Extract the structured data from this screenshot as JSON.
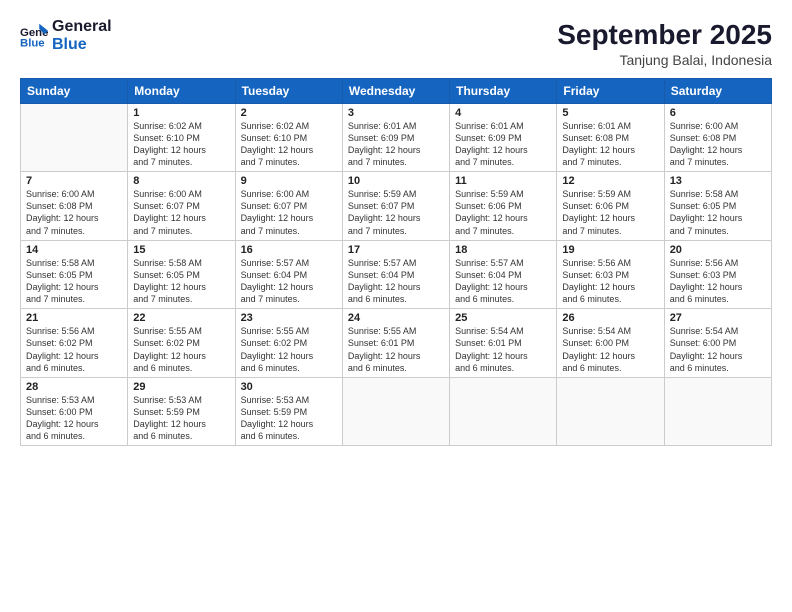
{
  "logo": {
    "line1": "General",
    "line2": "Blue"
  },
  "header": {
    "title": "September 2025",
    "subtitle": "Tanjung Balai, Indonesia"
  },
  "weekdays": [
    "Sunday",
    "Monday",
    "Tuesday",
    "Wednesday",
    "Thursday",
    "Friday",
    "Saturday"
  ],
  "weeks": [
    [
      {
        "day": "",
        "info": ""
      },
      {
        "day": "1",
        "info": "Sunrise: 6:02 AM\nSunset: 6:10 PM\nDaylight: 12 hours\nand 7 minutes."
      },
      {
        "day": "2",
        "info": "Sunrise: 6:02 AM\nSunset: 6:10 PM\nDaylight: 12 hours\nand 7 minutes."
      },
      {
        "day": "3",
        "info": "Sunrise: 6:01 AM\nSunset: 6:09 PM\nDaylight: 12 hours\nand 7 minutes."
      },
      {
        "day": "4",
        "info": "Sunrise: 6:01 AM\nSunset: 6:09 PM\nDaylight: 12 hours\nand 7 minutes."
      },
      {
        "day": "5",
        "info": "Sunrise: 6:01 AM\nSunset: 6:08 PM\nDaylight: 12 hours\nand 7 minutes."
      },
      {
        "day": "6",
        "info": "Sunrise: 6:00 AM\nSunset: 6:08 PM\nDaylight: 12 hours\nand 7 minutes."
      }
    ],
    [
      {
        "day": "7",
        "info": "Sunrise: 6:00 AM\nSunset: 6:08 PM\nDaylight: 12 hours\nand 7 minutes."
      },
      {
        "day": "8",
        "info": "Sunrise: 6:00 AM\nSunset: 6:07 PM\nDaylight: 12 hours\nand 7 minutes."
      },
      {
        "day": "9",
        "info": "Sunrise: 6:00 AM\nSunset: 6:07 PM\nDaylight: 12 hours\nand 7 minutes."
      },
      {
        "day": "10",
        "info": "Sunrise: 5:59 AM\nSunset: 6:07 PM\nDaylight: 12 hours\nand 7 minutes."
      },
      {
        "day": "11",
        "info": "Sunrise: 5:59 AM\nSunset: 6:06 PM\nDaylight: 12 hours\nand 7 minutes."
      },
      {
        "day": "12",
        "info": "Sunrise: 5:59 AM\nSunset: 6:06 PM\nDaylight: 12 hours\nand 7 minutes."
      },
      {
        "day": "13",
        "info": "Sunrise: 5:58 AM\nSunset: 6:05 PM\nDaylight: 12 hours\nand 7 minutes."
      }
    ],
    [
      {
        "day": "14",
        "info": "Sunrise: 5:58 AM\nSunset: 6:05 PM\nDaylight: 12 hours\nand 7 minutes."
      },
      {
        "day": "15",
        "info": "Sunrise: 5:58 AM\nSunset: 6:05 PM\nDaylight: 12 hours\nand 7 minutes."
      },
      {
        "day": "16",
        "info": "Sunrise: 5:57 AM\nSunset: 6:04 PM\nDaylight: 12 hours\nand 7 minutes."
      },
      {
        "day": "17",
        "info": "Sunrise: 5:57 AM\nSunset: 6:04 PM\nDaylight: 12 hours\nand 6 minutes."
      },
      {
        "day": "18",
        "info": "Sunrise: 5:57 AM\nSunset: 6:04 PM\nDaylight: 12 hours\nand 6 minutes."
      },
      {
        "day": "19",
        "info": "Sunrise: 5:56 AM\nSunset: 6:03 PM\nDaylight: 12 hours\nand 6 minutes."
      },
      {
        "day": "20",
        "info": "Sunrise: 5:56 AM\nSunset: 6:03 PM\nDaylight: 12 hours\nand 6 minutes."
      }
    ],
    [
      {
        "day": "21",
        "info": "Sunrise: 5:56 AM\nSunset: 6:02 PM\nDaylight: 12 hours\nand 6 minutes."
      },
      {
        "day": "22",
        "info": "Sunrise: 5:55 AM\nSunset: 6:02 PM\nDaylight: 12 hours\nand 6 minutes."
      },
      {
        "day": "23",
        "info": "Sunrise: 5:55 AM\nSunset: 6:02 PM\nDaylight: 12 hours\nand 6 minutes."
      },
      {
        "day": "24",
        "info": "Sunrise: 5:55 AM\nSunset: 6:01 PM\nDaylight: 12 hours\nand 6 minutes."
      },
      {
        "day": "25",
        "info": "Sunrise: 5:54 AM\nSunset: 6:01 PM\nDaylight: 12 hours\nand 6 minutes."
      },
      {
        "day": "26",
        "info": "Sunrise: 5:54 AM\nSunset: 6:00 PM\nDaylight: 12 hours\nand 6 minutes."
      },
      {
        "day": "27",
        "info": "Sunrise: 5:54 AM\nSunset: 6:00 PM\nDaylight: 12 hours\nand 6 minutes."
      }
    ],
    [
      {
        "day": "28",
        "info": "Sunrise: 5:53 AM\nSunset: 6:00 PM\nDaylight: 12 hours\nand 6 minutes."
      },
      {
        "day": "29",
        "info": "Sunrise: 5:53 AM\nSunset: 5:59 PM\nDaylight: 12 hours\nand 6 minutes."
      },
      {
        "day": "30",
        "info": "Sunrise: 5:53 AM\nSunset: 5:59 PM\nDaylight: 12 hours\nand 6 minutes."
      },
      {
        "day": "",
        "info": ""
      },
      {
        "day": "",
        "info": ""
      },
      {
        "day": "",
        "info": ""
      },
      {
        "day": "",
        "info": ""
      }
    ]
  ]
}
